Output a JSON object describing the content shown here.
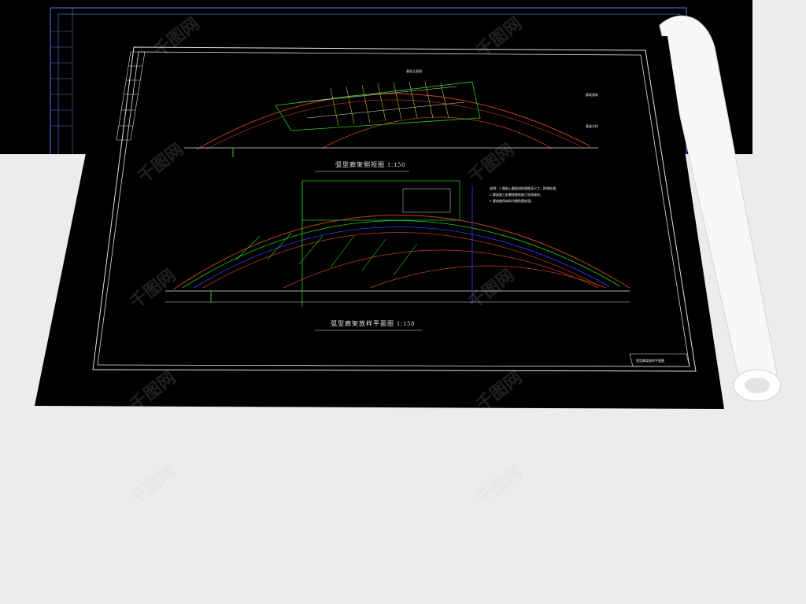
{
  "drawing_top": {
    "elevation_title": "弧型廊架侧视图 1:150",
    "plan_title": "弧型廊架放样平面图 1:150",
    "notes": [
      "说明：1. 图纸上廊架材料规格及尺寸。防锈处理。",
      "2. 廊架施工前需按图纸施工现场放样。",
      "3. 廊架使用材料均需防腐处理。"
    ],
    "titleblock": "弧型廊架放样平面图"
  },
  "drawing_bottom": {
    "callouts": [
      "廊架立面图",
      "廊架基础",
      "基础大样"
    ]
  },
  "watermark_text": "千图网",
  "colors": {
    "sheet": "#000000",
    "frame": "#e0e0e0",
    "arc_red": "#c04020",
    "arc_green": "#20d020",
    "arc_blue": "#3040ff",
    "bg": "#ececec"
  }
}
